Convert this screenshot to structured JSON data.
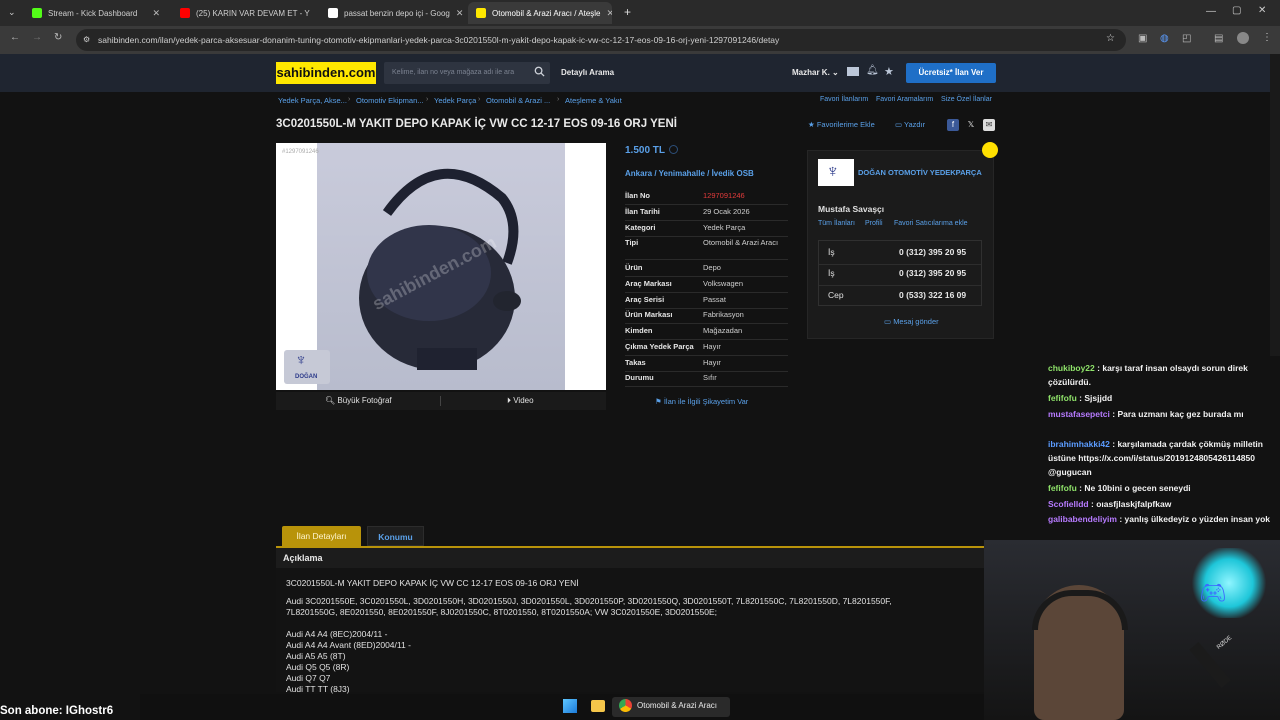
{
  "browser": {
    "tabs": [
      {
        "label": "Stream - Kick Dashboard",
        "fav": "#53fc18"
      },
      {
        "label": "(25) KARIN VAR DEVAM ET - Y",
        "fav": "#ff0000"
      },
      {
        "label": "passat benzin depo içi - Goog",
        "fav": "#ffffff"
      },
      {
        "label": "Otomobil & Arazi Aracı / Ateşle",
        "fav": "#ffe800"
      }
    ],
    "new_tab": "+",
    "url": "sahibinden.com/ilan/yedek-parca-aksesuar-donanim-tuning-otomotiv-ekipmanlari-yedek-parca-3c0201550l-m-yakit-depo-kapak-ic-vw-cc-12-17-eos-09-16-orj-yeni-1297091246/detay"
  },
  "header": {
    "logo": "sahibinden.com",
    "search_placeholder": "Kelime, ilan no veya mağaza adı ile ara",
    "advanced_search": "Detaylı Arama",
    "user": "Mazhar K.",
    "post_ad": "Ücretsiz* İlan Ver"
  },
  "breadcrumb": [
    "Yedek Parça, Akse...",
    "Otomotiv Ekipman...",
    "Yedek Parça",
    "Otomobil & Arazi ...",
    "Ateşleme & Yakıt"
  ],
  "top_links": [
    "Favori İlanlarım",
    "Favori Aramalarım",
    "Size Özel İlanlar"
  ],
  "listing": {
    "title": "3C0201550L-M YAKIT DEPO KAPAK İÇ VW CC 12-17 EOS 09-16 ORJ YENİ",
    "add_favorite": "Favorilerime Ekle",
    "print": "Yazdır",
    "photo_id": "#1297091246",
    "photo_logo_text": "DOĞAN",
    "watermark": "sahibinden.com",
    "big_photo": "Büyük Fotoğraf",
    "video": "Video",
    "price": "1.500 TL",
    "location": "Ankara  /  Yenimahalle  /  İvedik OSB",
    "details": [
      {
        "key": "İlan No",
        "value": "1297091246",
        "red": true
      },
      {
        "key": "İlan Tarihi",
        "value": "29 Ocak 2026"
      },
      {
        "key": "Kategori",
        "value": "Yedek Parça"
      },
      {
        "key": "Tipi",
        "value": "Otomobil & Arazi Aracı"
      },
      {
        "key": "Ürün",
        "value": "Depo"
      },
      {
        "key": "Araç Markası",
        "value": "Volkswagen"
      },
      {
        "key": "Araç Serisi",
        "value": "Passat"
      },
      {
        "key": "Ürün Markası",
        "value": "Fabrikasyon"
      },
      {
        "key": "Kimden",
        "value": "Mağazadan"
      },
      {
        "key": "Çıkma Yedek Parça",
        "value": "Hayır"
      },
      {
        "key": "Takas",
        "value": "Hayır"
      },
      {
        "key": "Durumu",
        "value": "Sıfır"
      }
    ],
    "complaint": "İlan ile İlgili Şikayetim Var"
  },
  "seller": {
    "store": "DOĞAN OTOMOTİV YEDEKPARÇA",
    "name": "Mustafa Savaşçı",
    "links": [
      "Tüm İlanları",
      "Profili",
      "Favori Satıcılarıma ekle"
    ],
    "phones": [
      {
        "type": "İş",
        "number": "0 (312) 395 20 95"
      },
      {
        "type": "İş",
        "number": "0 (312) 395 20 95"
      },
      {
        "type": "Cep",
        "number": "0 (533) 322 16 09"
      }
    ],
    "message": "Mesaj gönder"
  },
  "tabs": {
    "details": "İlan Detayları",
    "location": "Konumu"
  },
  "description": {
    "heading": "Açıklama",
    "lines": [
      "3C0201550L-M YAKIT DEPO KAPAK İÇ VW CC 12-17 EOS 09-16 ORJ YENİ",
      "Audi 3C0201550E, 3C0201550L, 3D0201550H, 3D0201550J, 3D0201550L, 3D0201550P, 3D0201550Q, 3D0201550T, 7L8201550C, 7L8201550D, 7L8201550F,",
      "7L8201550G, 8E0201550, 8E0201550F, 8J0201550C, 8T0201550, 8T0201550A; VW 3C0201550E, 3D0201550E;",
      "",
      "Audi A4 A4 (8EC)2004/11 -",
      "Audi A4 A4 Avant (8ED)2004/11 -",
      "Audi A5 A5 (8T)",
      "Audi Q5 Q5 (8R)",
      "Audi Q7 Q7",
      "Audi TT TT (8J3)"
    ]
  },
  "chat": [
    {
      "user": "chukiboy22",
      "color": "#8fe36a",
      "text": ": karşı taraf insan olsaydı sorun direk çözülürdü."
    },
    {
      "user": "fefifofu",
      "color": "#8fe36a",
      "text": ": Sjsjjdd"
    },
    {
      "user": "mustafasepetci",
      "color": "#b77bff",
      "text": ": Para uzmanı kaç gez burada mı"
    },
    {
      "user": "ibrahimhakki42",
      "color": "#5b9cff",
      "text": ": karşılamada çardak çökmüş milletin üstüne https://x.com/i/status/2019124805426114850 @gugucan"
    },
    {
      "user": "fefifofu",
      "color": "#8fe36a",
      "text": ": Ne 10bini o gecen seneydi"
    },
    {
      "user": "Scofielldd",
      "color": "#b77bff",
      "text": ": oıasfjlaskjfalpfkaw"
    },
    {
      "user": "galibabendeliyim",
      "color": "#b77bff",
      "text": ": yanlış ülkedeyiz o yüzden insan yok"
    }
  ],
  "overlay": {
    "sub_label": "Son abone: IGhostr6",
    "webcam_mic_label": "RØDE"
  },
  "taskbar": {
    "active_window": "Otomobil & Arazi Aracı"
  },
  "colors": {
    "link": "#5aa0e8",
    "brand_yellow": "#ffe800",
    "cta_blue": "#1f6fc7",
    "tab_gold": "#b8930a"
  }
}
